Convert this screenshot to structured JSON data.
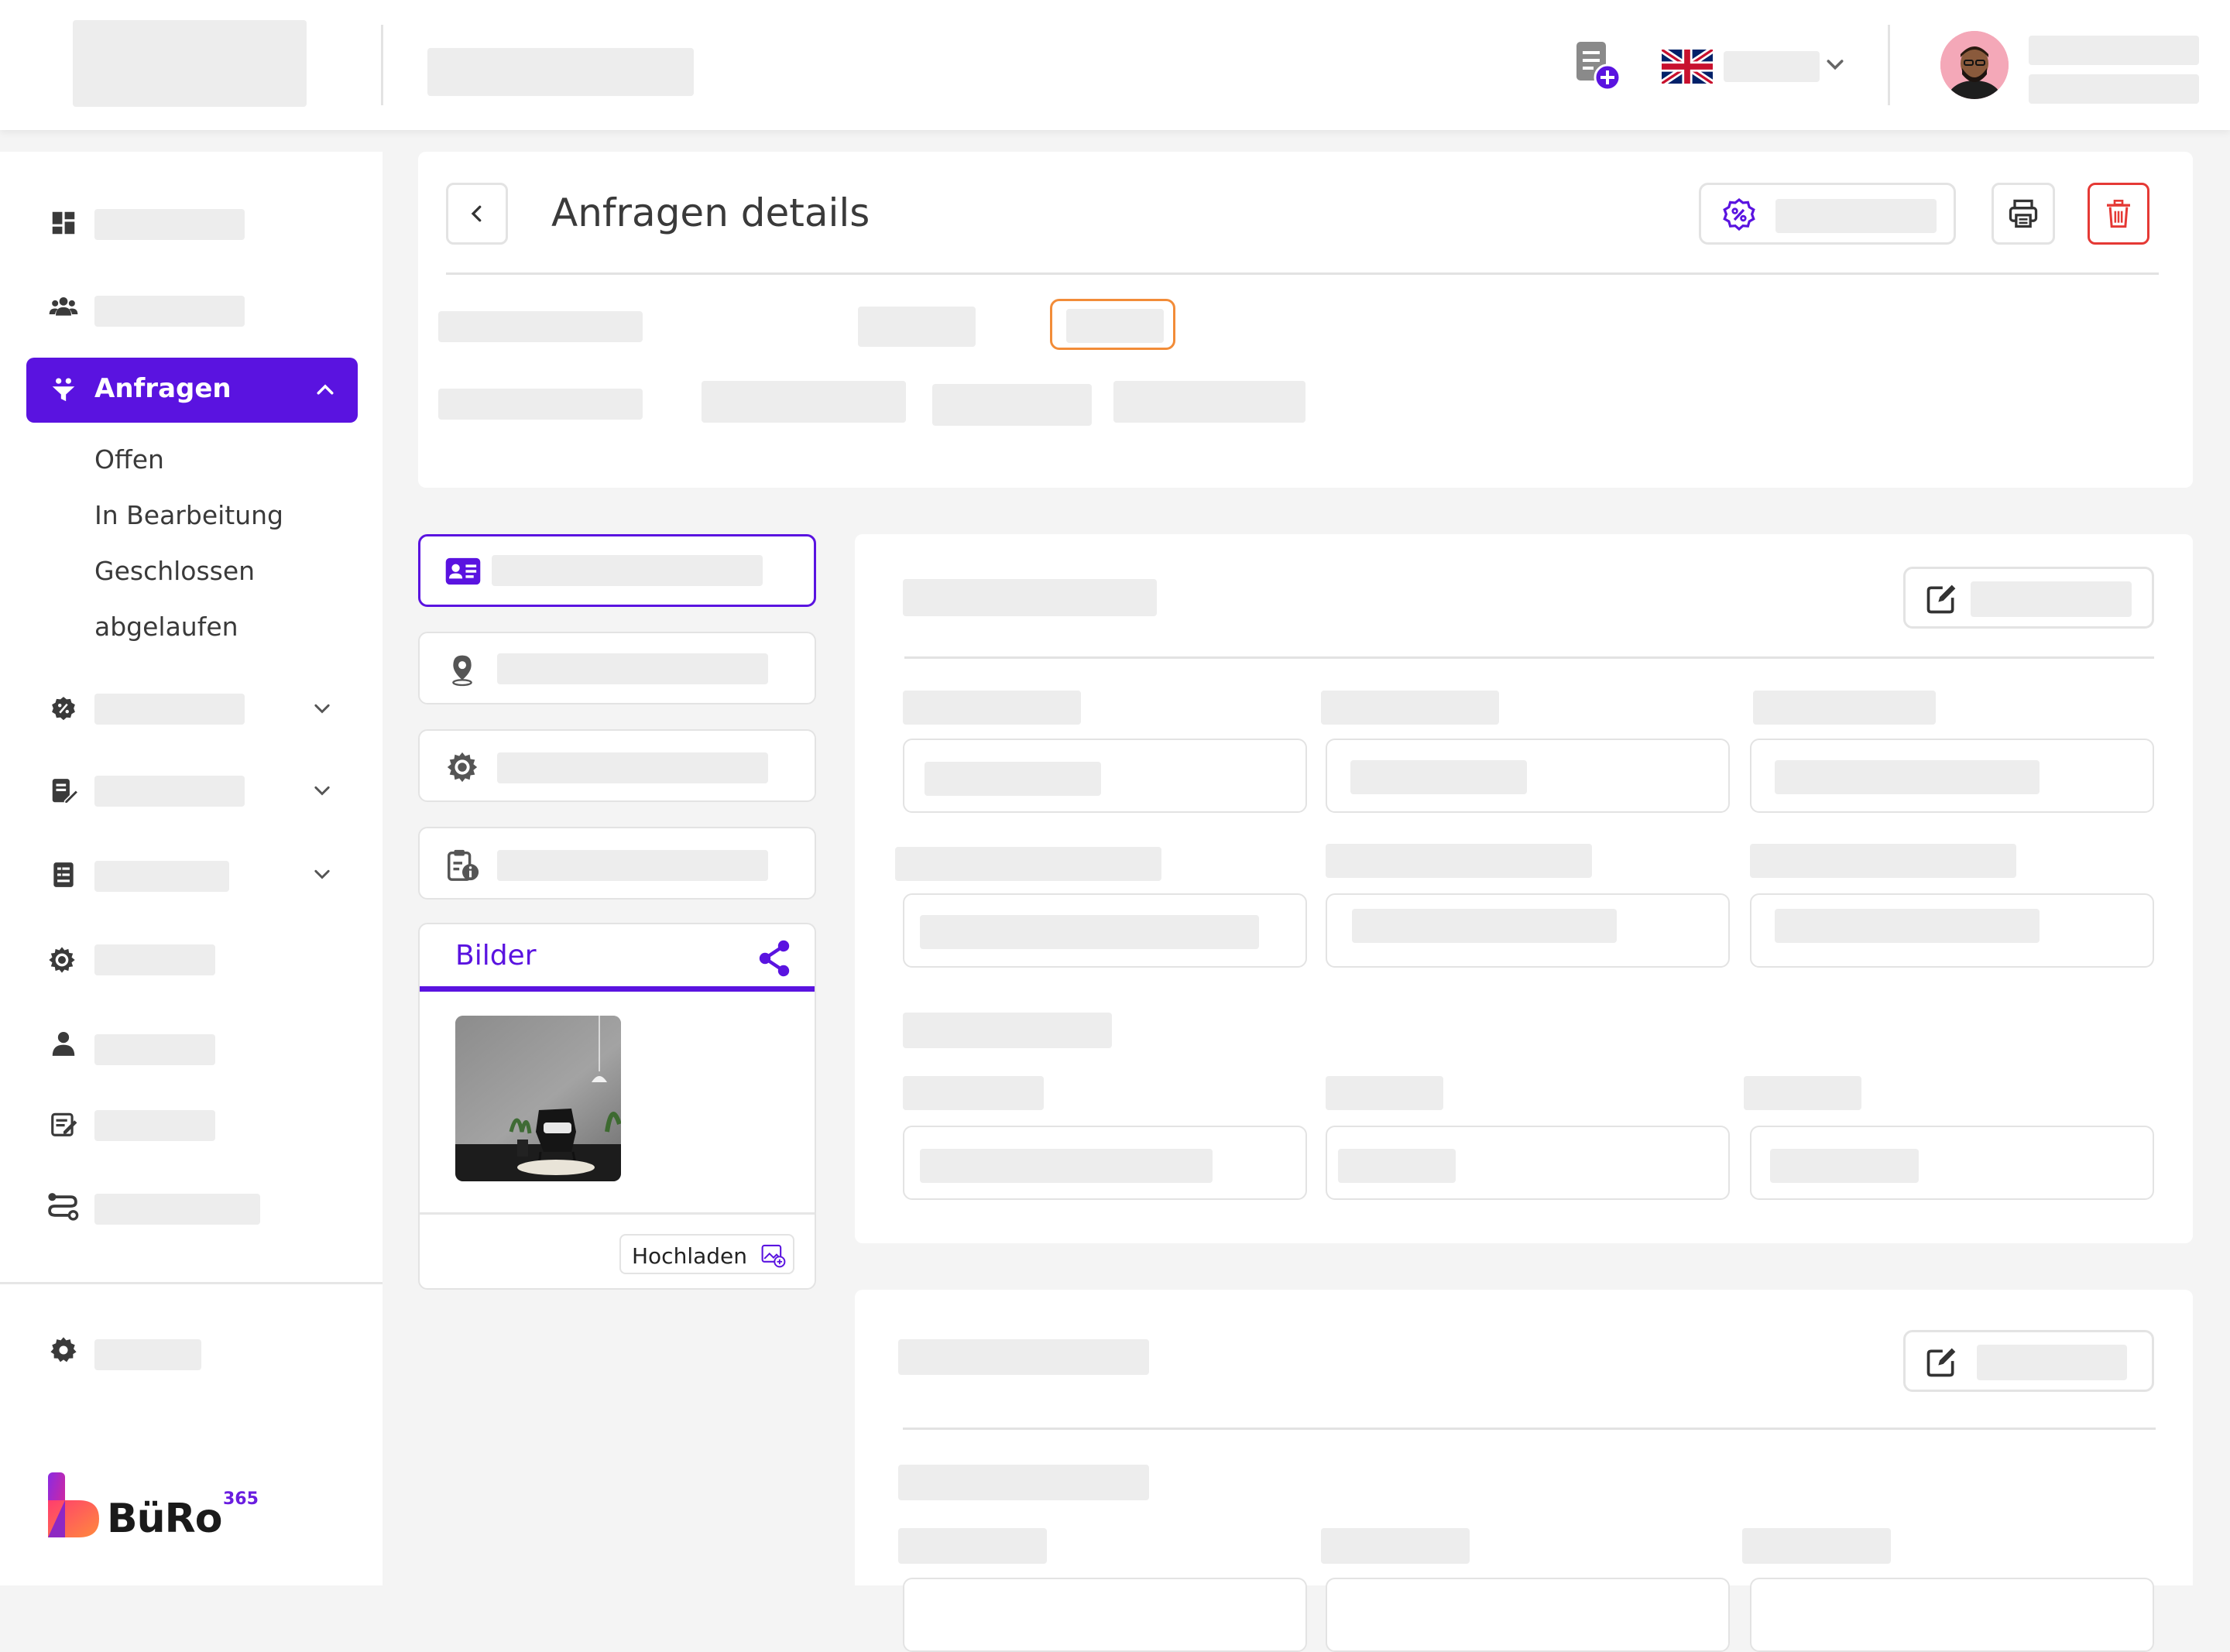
{
  "colors": {
    "accent": "#5a13e0",
    "danger": "#e53935",
    "status_orange": "#f28c38",
    "logo_gradient": [
      "#8a2be2",
      "#ff6a3d"
    ]
  },
  "header": {
    "icons": [
      "add-document-icon",
      "uk-flag-icon",
      "chevron-down-icon",
      "avatar"
    ]
  },
  "sidebar": {
    "active_item": "Anfragen",
    "subitems": [
      "Offen",
      "In Bearbeitung",
      "Geschlossen",
      "abgelaufen"
    ],
    "icons": [
      "dashboard-icon",
      "users-icon",
      "funnel-icon",
      "discount-badge-icon",
      "edit-document-icon",
      "invoice-icon",
      "settings-cog-icon",
      "person-icon",
      "form-icon",
      "route-icon",
      "settings-icon"
    ]
  },
  "logo": {
    "text": "BüRo",
    "superscript": "365"
  },
  "details": {
    "title": "Anfragen details"
  },
  "images_card": {
    "title": "Bilder",
    "upload_label": "Hochladen"
  }
}
